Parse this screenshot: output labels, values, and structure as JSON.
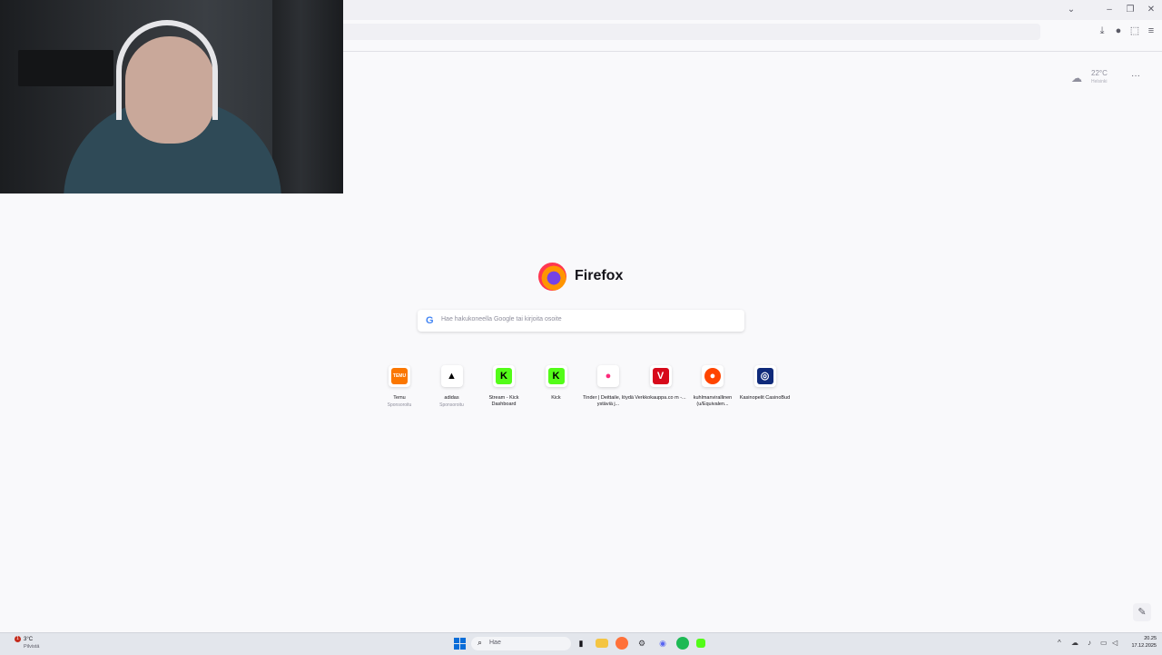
{
  "window": {
    "controls": [
      "⌄",
      "–",
      "❐",
      "✕"
    ]
  },
  "toolbar": {
    "icons": [
      "download-icon",
      "account-icon",
      "extensions-icon",
      "menu-icon"
    ]
  },
  "weather": {
    "temp": "22°C",
    "location": "Helsinki",
    "more": "···"
  },
  "brand": {
    "name": "Firefox"
  },
  "search": {
    "placeholder": "Hae hakukoneella Google tai kirjoita osoite",
    "engine_glyph": "G"
  },
  "top_sites": [
    {
      "label": "Temu",
      "sub": "Sponsoroitu",
      "glyph": "TEMU",
      "bg": "#fb7701",
      "fg": "#ffffff"
    },
    {
      "label": "adidas",
      "sub": "Sponsoroitu",
      "glyph": "▲",
      "bg": "#ffffff",
      "fg": "#000000"
    },
    {
      "label": "Stream - Kick Dashboard",
      "sub": "",
      "glyph": "K",
      "bg": "#53fc18",
      "fg": "#000000"
    },
    {
      "label": "Kick",
      "sub": "",
      "glyph": "K",
      "bg": "#53fc18",
      "fg": "#000000"
    },
    {
      "label": "Tinder | Deittaile, löydä ystäviä j...",
      "sub": "",
      "glyph": "●",
      "bg": "#ffffff",
      "fg": "#fd297b"
    },
    {
      "label": "Verkkokauppa.co m -...",
      "sub": "",
      "glyph": "V",
      "bg": "#d7091a",
      "fg": "#ffffff"
    },
    {
      "label": "kuhlmanvirallinen (u/Equivalen...",
      "sub": "",
      "glyph": "●",
      "bg": "#ff4500",
      "fg": "#ffffff"
    },
    {
      "label": "Kasinopelit CasinoBud",
      "sub": "",
      "glyph": "◎",
      "bg": "#0f2a7a",
      "fg": "#ffffff"
    }
  ],
  "taskbar": {
    "weather_temp": "3°C",
    "weather_desc": "Pilvistä",
    "weather_badge": "1",
    "search_text": "Hae",
    "time": "20.25",
    "date": "17.12.2025"
  }
}
